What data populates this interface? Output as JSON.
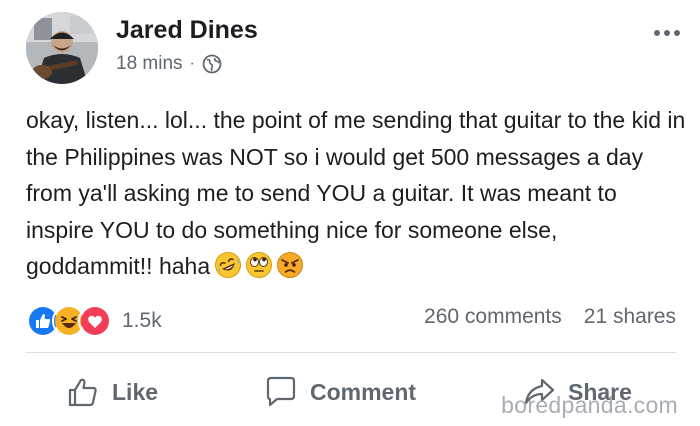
{
  "post": {
    "author": "Jared Dines",
    "time": "18 mins",
    "separator": "·",
    "privacy_icon": "globe-icon",
    "text": "okay, listen... lol... the point of me sending that guitar to the kid in the Philippines was NOT so i would get 500 messages a day from ya'll asking me to send YOU a guitar. It was meant to inspire YOU to do something nice for someone else, goddammit!! haha",
    "emojis": [
      "rolling-on-floor-laughing-emoji",
      "eye-roll-emoji",
      "angry-face-emoji"
    ]
  },
  "engagement": {
    "reactions": [
      "like",
      "haha",
      "love"
    ],
    "reaction_count": "1.5k",
    "comments": "260 comments",
    "shares": "21 shares"
  },
  "actions": {
    "like_label": "Like",
    "comment_label": "Comment",
    "share_label": "Share"
  },
  "watermark": "boredpanda.com",
  "colors": {
    "like_blue": "#1877f2",
    "love_red": "#f33e58",
    "haha_yellow": "#f7b125",
    "muted_text": "#606770",
    "primary_text": "#1c1e21"
  }
}
